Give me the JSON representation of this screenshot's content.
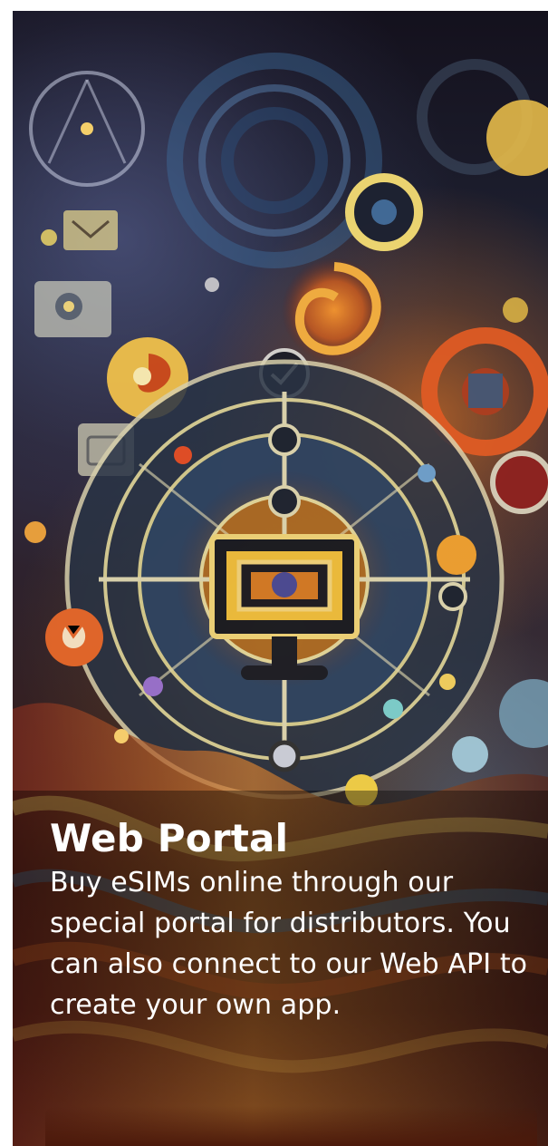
{
  "card": {
    "title": "Web Portal",
    "description": "Buy eSIMs online through our special portal for distributors. You can also connect to our Web API to create your own app."
  },
  "colors": {
    "text": "#ffffff",
    "background": "#ffffff",
    "accent_gold": "#e3c260",
    "accent_orange": "#d86b20",
    "accent_blue": "#6ea3cf"
  }
}
